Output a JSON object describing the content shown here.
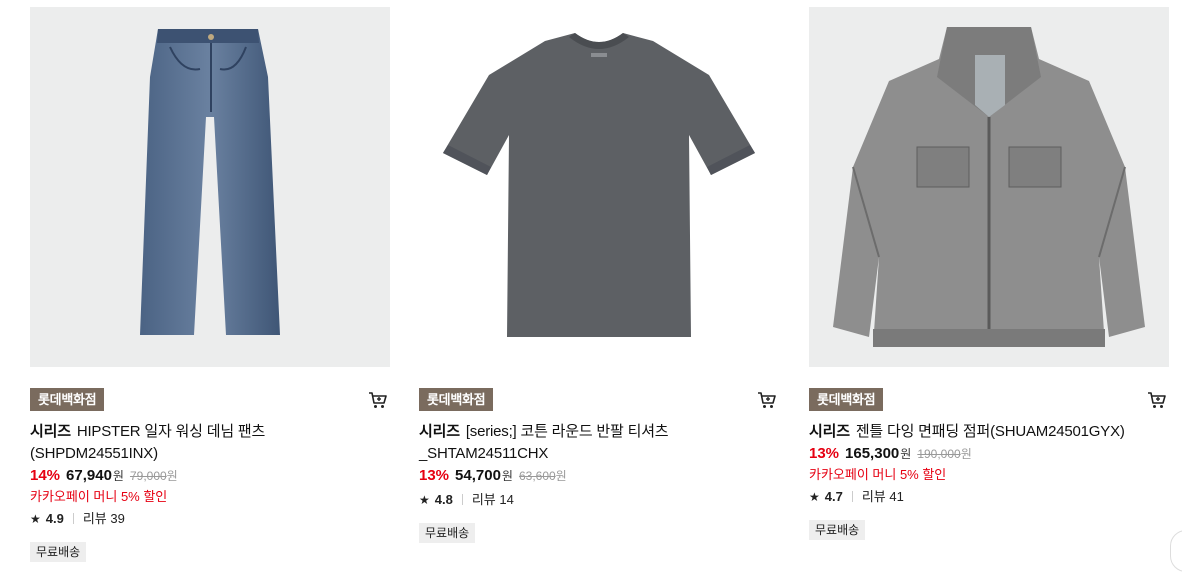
{
  "products": [
    {
      "store": "롯데백화점",
      "brand": "시리즈",
      "name": "HIPSTER 일자 워싱 데님 팬츠",
      "name2": "(SHPDM24551INX)",
      "discount": "14%",
      "price": "67,940",
      "won": "원",
      "original_price": "79,000",
      "promo": "카카오페이 머니 5% 할인",
      "rating": "4.9",
      "review_label": "리뷰 39",
      "shipping": "무료배송",
      "image": "denim-jeans"
    },
    {
      "store": "롯데백화점",
      "brand": "시리즈",
      "name": "[series;] 코튼 라운드 반팔 티셔츠",
      "name2": "_SHTAM24511CHX",
      "discount": "13%",
      "price": "54,700",
      "won": "원",
      "original_price": "63,600",
      "promo": "",
      "rating": "4.8",
      "review_label": "리뷰 14",
      "shipping": "무료배송",
      "image": "grey-tshirt"
    },
    {
      "store": "롯데백화점",
      "brand": "시리즈",
      "name": "젠틀 다잉 면패딩 점퍼(SHUAM24501GYX)",
      "name2": "",
      "discount": "13%",
      "price": "165,300",
      "won": "원",
      "original_price": "190,000",
      "promo": "카카오페이 머니 5% 할인",
      "rating": "4.7",
      "review_label": "리뷰 41",
      "shipping": "무료배송",
      "image": "grey-jacket"
    }
  ],
  "icons": {
    "cart": "cart-icon",
    "star": "star-icon"
  },
  "colors": {
    "discount": "#e60012",
    "store_badge": "#7a6b5e",
    "thumb_bg": "#eceded"
  }
}
